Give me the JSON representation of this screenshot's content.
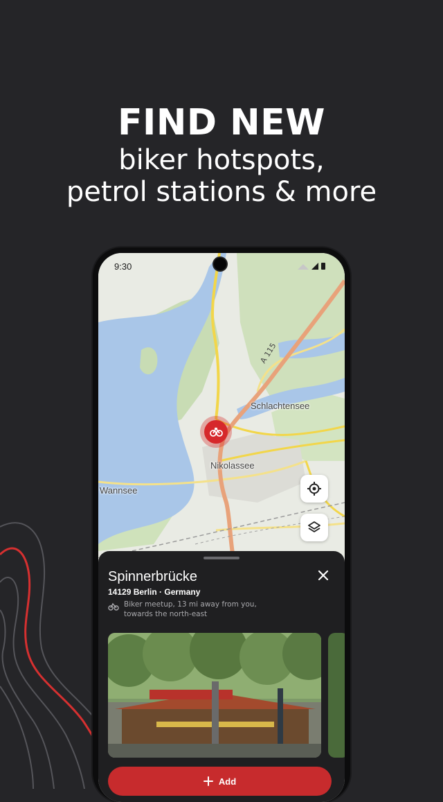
{
  "headline": {
    "title": "FIND NEW",
    "line1": "biker hotspots,",
    "line2": "petrol stations & more"
  },
  "status_bar": {
    "time": "9:30"
  },
  "map": {
    "labels": {
      "road": "A 115",
      "place1": "Schlachtensee",
      "place2": "Nikolassee",
      "place3": "Wannsee"
    }
  },
  "place": {
    "name": "Spinnerbrücke",
    "address": "14129 Berlin · Germany",
    "description": "Biker meetup, 13 mi away from you, towards the north-east"
  },
  "actions": {
    "add_label": "Add"
  },
  "icons": {
    "locate": "crosshair-icon",
    "layers": "layers-icon",
    "pin": "biker-pin-icon",
    "close": "close-icon",
    "meta": "biker-icon",
    "add": "plus-icon"
  },
  "colors": {
    "background": "#252528",
    "accent": "#d6282b",
    "sheet": "#1f1f21",
    "water": "#a9c6e8",
    "forest": "#c8dcb4"
  }
}
